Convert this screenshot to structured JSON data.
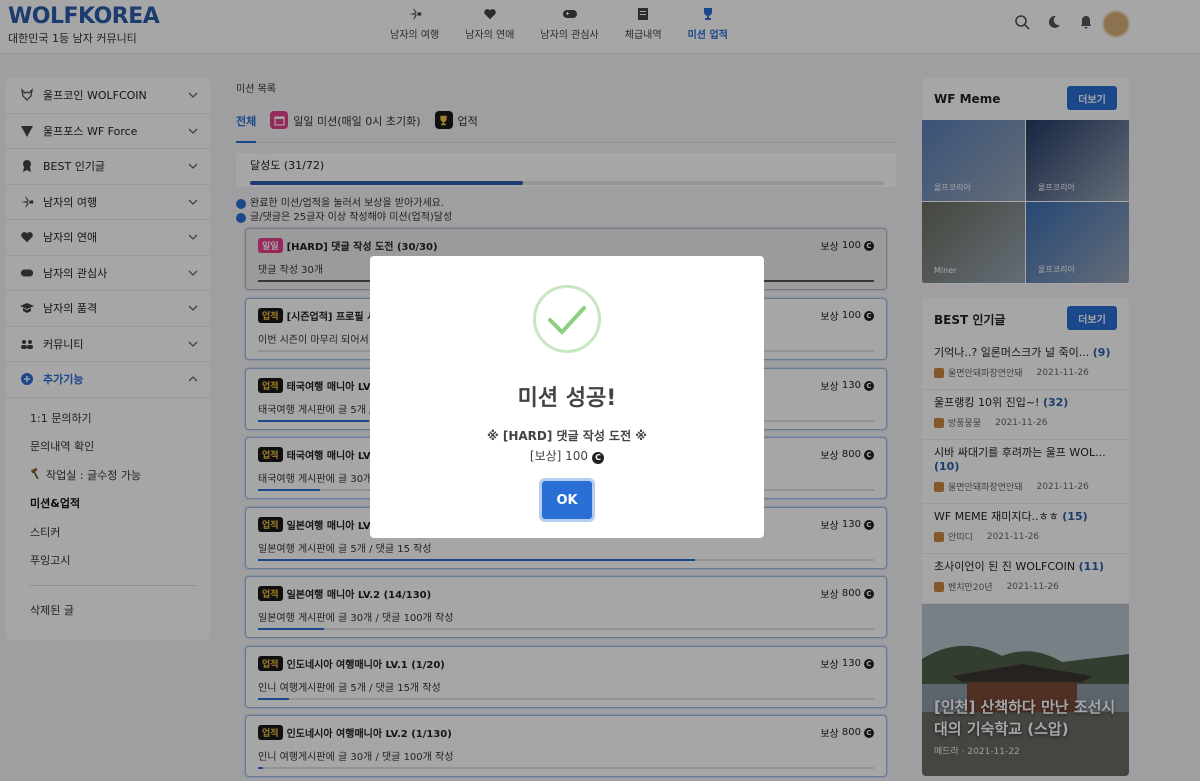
{
  "header": {
    "logo": "WOLFKOREA",
    "tagline": "대한민국 1등 남자 커뮤니티",
    "nav": [
      {
        "label": "남자의 여행",
        "icon": "plane-icon"
      },
      {
        "label": "남자의 연애",
        "icon": "heart-icon"
      },
      {
        "label": "남자의 관심사",
        "icon": "gamepad-icon"
      },
      {
        "label": "체급내역",
        "icon": "receipt-icon"
      },
      {
        "label": "미션 업적",
        "icon": "trophy-icon",
        "active": true
      }
    ]
  },
  "sidebar": {
    "items": [
      {
        "label": "울프코인 WOLFCOIN",
        "icon": "wolf-icon"
      },
      {
        "label": "울프포스 WF Force",
        "icon": "shield-v-icon"
      },
      {
        "label": "BEST 인기글",
        "icon": "medal-icon"
      },
      {
        "label": "남자의 여행",
        "icon": "plane-icon"
      },
      {
        "label": "남자의 연애",
        "icon": "heart-icon"
      },
      {
        "label": "남자의 관심사",
        "icon": "gamepad-icon"
      },
      {
        "label": "남자의 품격",
        "icon": "graduation-cap-icon"
      },
      {
        "label": "커뮤니티",
        "icon": "users-icon"
      },
      {
        "label": "추가기능",
        "icon": "plus-circle-icon",
        "active": true
      }
    ],
    "sub": [
      "1:1 문의하기",
      "문의내역 확인",
      "작업실 : 글수정 가능",
      "미션&업적",
      "스티커",
      "푸잉고시"
    ],
    "deleted": "삭제된 글"
  },
  "main": {
    "title": "미션 목록",
    "tabs": [
      "전체",
      "일일 미션(매일 0시 초기화)",
      "업적"
    ],
    "progress_label": "달성도 (31/72)",
    "progress": 0.431,
    "notes": [
      "완료한 미션/업적을 눌러서 보상을 받아가세요.",
      "글/댓글은 25글자 이상 작성해야 미션(업적)달성"
    ],
    "reward_prefix": "보상",
    "cards": [
      {
        "badge": "일일",
        "type": "daily",
        "title": "[HARD] 댓글 작성 도전 (30/30)",
        "desc": "댓글 작성 30개",
        "reward": "100",
        "progress": 1.0,
        "done": true
      },
      {
        "badge": "업적",
        "type": "ach",
        "title": "[시즌업적] 프로필 사",
        "desc": "이번 시즌이 마무리 되어서 자",
        "reward": "100",
        "progress": 0
      },
      {
        "badge": "업적",
        "type": "ach",
        "title": "태국여행 매니아 LV",
        "desc": "태국여행 게시판에 글 5개 / 댓",
        "reward": "130",
        "progress": 0.18
      },
      {
        "badge": "업적",
        "type": "ach",
        "title": "태국여행 매니아 LV",
        "desc": "태국여행 게시판에 글 30개 / 댓",
        "reward": "800",
        "progress": 0.1
      },
      {
        "badge": "업적",
        "type": "ach",
        "title": "일본여행 매니아 LV",
        "desc": "일본여행 게시판에 글 5개 / 댓글 15 작성",
        "reward": "130",
        "progress": 0.71
      },
      {
        "badge": "업적",
        "type": "ach",
        "title": "일본여행 매니아 LV.2 (14/130)",
        "desc": "일본여행 게시판에 글 30개 / 댓글 100개 작성",
        "reward": "800",
        "progress": 0.107
      },
      {
        "badge": "업적",
        "type": "ach",
        "title": "인도네시아 여행매니아 LV.1 (1/20)",
        "desc": "인니 여행게시판에 글 5개 / 댓글 15개 작성",
        "reward": "130",
        "progress": 0.05
      },
      {
        "badge": "업적",
        "type": "ach",
        "title": "인도네시아 여행매니아 LV.2 (1/130)",
        "desc": "인니 여행게시판에 글 30개 / 댓글 100개 작성",
        "reward": "800",
        "progress": 0.008
      }
    ]
  },
  "meme": {
    "title": "WF Meme",
    "more": "더보기",
    "items": [
      {
        "caption": "울프코리아",
        "color": "#5a7fb8"
      },
      {
        "caption": "울프코리아",
        "color": "#223a66"
      },
      {
        "caption": "Miner",
        "color": "#6a6f5e"
      },
      {
        "caption": "울프코리아",
        "color": "#3d6fb5"
      }
    ]
  },
  "best": {
    "title": "BEST 인기글",
    "more": "더보기",
    "posts": [
      {
        "title": "기억나..? 일론머스크가 널 죽이...",
        "count": "(9)",
        "author": "울면안돼파장연안돼",
        "date": "2021-11-26"
      },
      {
        "title": "울프랭킹 10위 진입~!",
        "count": "(32)",
        "author": "방풍뭉뭉",
        "date": "2021-11-26"
      },
      {
        "title": "시바 싸대기를 후려까는 울프 WOL...",
        "count": "(10)",
        "author": "울면안돼파장연안돼",
        "date": "2021-11-26"
      },
      {
        "title": "WF MEME 재미지다..ㅎㅎ",
        "count": "(15)",
        "author": "안띠디",
        "date": "2021-11-26"
      },
      {
        "title": "초사이언이 된 진 WOLFCOIN",
        "count": "(11)",
        "author": "벤치만20년",
        "date": "2021-11-26"
      }
    ],
    "photo": {
      "title": "[인천] 산책하다 만난 조선시대의 기숙학교 (스압)",
      "meta": "메드라 · 2021-11-22"
    }
  },
  "modal": {
    "title": "미션 성공!",
    "mission": "※ [HARD] 댓글 작성 도전 ※",
    "reward": "[보상] 100",
    "ok": "OK"
  }
}
